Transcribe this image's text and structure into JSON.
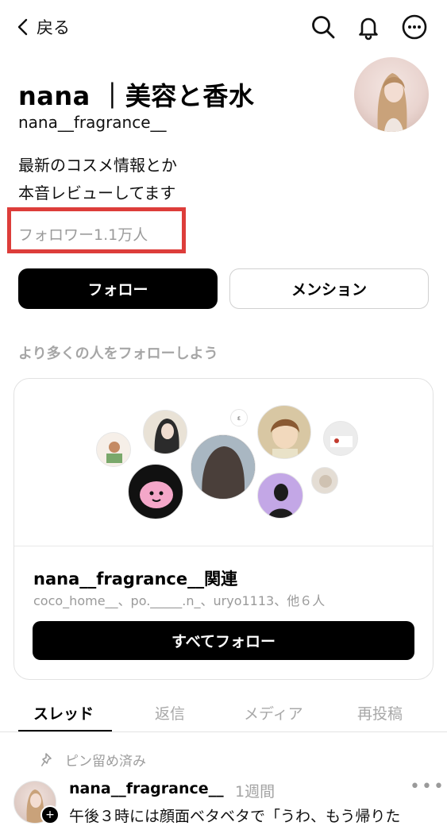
{
  "header": {
    "back_label": "戻る",
    "icons": [
      "search-icon",
      "bell-icon",
      "more-icon"
    ]
  },
  "profile": {
    "name": "nana ｜美容と香水",
    "handle": "nana__fragrance__",
    "bio": [
      "最新のコスメ情報とか",
      "本音レビューしてます"
    ],
    "followers": "フォロワー1.1万人",
    "highlight_color": "#dd3d3a"
  },
  "actions": {
    "follow_label": "フォロー",
    "mention_label": "メンション"
  },
  "suggestions": {
    "heading": "より多くの人をフォローしよう",
    "card_title": "nana__fragrance__関連",
    "card_subtitle": "coco_home__、po._____.n_、uryo1113、他６人",
    "follow_all_label": "すべてフォロー"
  },
  "tabs": [
    {
      "label": "スレッド",
      "active": true
    },
    {
      "label": "返信",
      "active": false
    },
    {
      "label": "メディア",
      "active": false
    },
    {
      "label": "再投稿",
      "active": false
    }
  ],
  "post": {
    "pinned_label": "ピン留め済み",
    "author": "nana__fragrance__",
    "time": "1週間",
    "more": "•••",
    "text": "午後３時には顔面ベタベタで「うわ、もう帰りた"
  },
  "colors": {
    "primary_button": "#000000",
    "muted_text": "#9b9b9b"
  }
}
